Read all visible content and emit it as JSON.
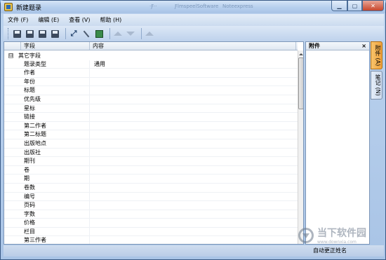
{
  "window": {
    "title": "新建题录",
    "background_titles": [
      "·Ƒ··",
      "ƑlmspeelSoftware",
      "Noteexpress"
    ]
  },
  "menu": [
    {
      "label": "文件 (F)"
    },
    {
      "label": "编辑 (E)"
    },
    {
      "label": "查看 (V)"
    },
    {
      "label": "帮助 (H)"
    }
  ],
  "toolbar": {
    "icons": [
      "save-new-icon",
      "save-icon",
      "copy-record-icon",
      "save-close-icon",
      "fullscreen-icon",
      "edit-icon",
      "app-icon",
      "move-up-icon",
      "move-down-icon",
      "move-top-icon"
    ]
  },
  "grid": {
    "col_field": "字段",
    "col_content": "内容",
    "group": {
      "expander": "⊟",
      "label": "其它字段"
    },
    "rows": [
      {
        "field": "题录类型",
        "value": "通用"
      },
      {
        "field": "作者",
        "value": ""
      },
      {
        "field": "年份",
        "value": ""
      },
      {
        "field": "标题",
        "value": ""
      },
      {
        "field": "优先级",
        "value": ""
      },
      {
        "field": "星标",
        "value": ""
      },
      {
        "field": "链接",
        "value": ""
      },
      {
        "field": "第二作者",
        "value": ""
      },
      {
        "field": "第二标题",
        "value": ""
      },
      {
        "field": "出版地点",
        "value": ""
      },
      {
        "field": "出版社",
        "value": ""
      },
      {
        "field": "期刊",
        "value": ""
      },
      {
        "field": "卷",
        "value": ""
      },
      {
        "field": "期",
        "value": ""
      },
      {
        "field": "卷数",
        "value": ""
      },
      {
        "field": "编号",
        "value": ""
      },
      {
        "field": "页码",
        "value": ""
      },
      {
        "field": "字数",
        "value": ""
      },
      {
        "field": "价格",
        "value": ""
      },
      {
        "field": "栏目",
        "value": ""
      },
      {
        "field": "第三作者",
        "value": ""
      }
    ]
  },
  "attachments": {
    "title": "附件",
    "close": "×"
  },
  "side_tabs": [
    {
      "label": "附件 (A)",
      "active": true
    },
    {
      "label": "笔记 (N)",
      "active": false
    }
  ],
  "status": {
    "text": "自动更正姓名"
  },
  "watermark": {
    "text": "当下软件园",
    "sub": "www.downxia.com"
  }
}
